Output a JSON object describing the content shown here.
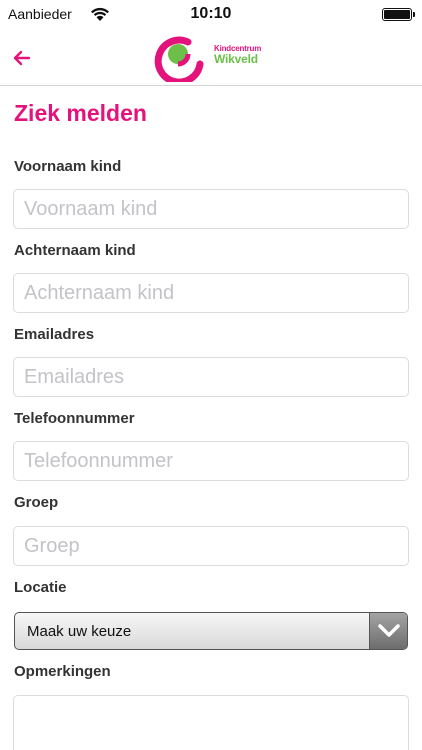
{
  "status_bar": {
    "carrier": "Aanbieder",
    "time": "10:10"
  },
  "header": {
    "logo_line1": "Kindcentrum",
    "logo_line2": "Wikveld",
    "colors": {
      "brand_pink": "#e4137b",
      "brand_green": "#6cc04a"
    }
  },
  "form": {
    "title": "Ziek melden",
    "first_name": {
      "label": "Voornaam kind",
      "placeholder": "Voornaam kind",
      "value": ""
    },
    "last_name": {
      "label": "Achternaam kind",
      "placeholder": "Achternaam kind",
      "value": ""
    },
    "email": {
      "label": "Emailadres",
      "placeholder": "Emailadres",
      "value": ""
    },
    "phone": {
      "label": "Telefoonnummer",
      "placeholder": "Telefoonnummer",
      "value": ""
    },
    "group": {
      "label": "Groep",
      "placeholder": "Groep",
      "value": ""
    },
    "location": {
      "label": "Locatie",
      "selected": "Maak uw keuze"
    },
    "remarks": {
      "label": "Opmerkingen",
      "value": ""
    }
  }
}
